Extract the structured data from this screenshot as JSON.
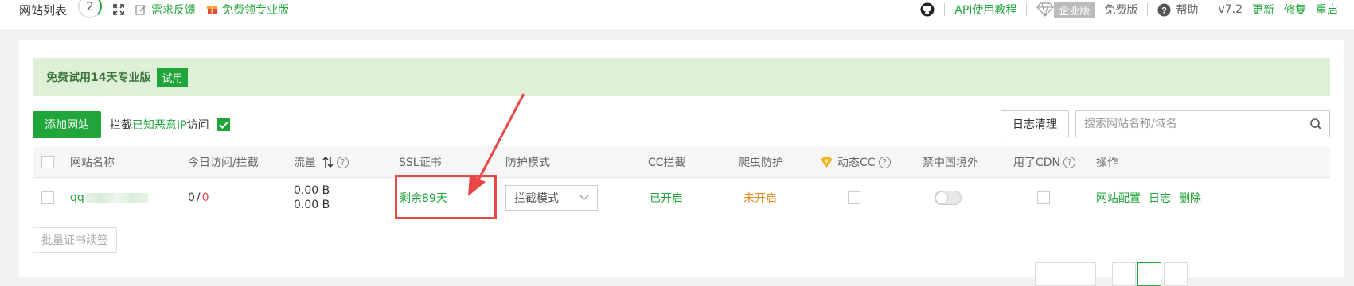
{
  "topbar": {
    "title": "网站列表",
    "site_count": "2",
    "feedback": "需求反馈",
    "free_pro": "免费领专业版",
    "api_tutorial": "API使用教程",
    "enterprise": "企业版",
    "free_edition": "免费版",
    "help": "帮助",
    "version": "v7.2",
    "update": "更新",
    "repair": "修复",
    "restart": "重启"
  },
  "notice": {
    "text": "免费试用14天专业版",
    "try_label": "试用"
  },
  "toolbar": {
    "add_site": "添加网站",
    "block_prefix": "拦截",
    "block_link": "已知恶意IP",
    "block_suffix": "访问",
    "log_clean": "日志清理",
    "search_placeholder": "搜索网站名称/域名"
  },
  "table": {
    "headers": {
      "name": "网站名称",
      "visits": "今日访问/拦截",
      "traffic": "流量",
      "ssl": "SSL证书",
      "protect_mode": "防护模式",
      "cc": "CC拦截",
      "crawler": "爬虫防护",
      "dynamic_cc": "动态CC",
      "block_foreign": "禁中国境外",
      "cdn": "用了CDN",
      "actions": "操作"
    },
    "rows": [
      {
        "name": "qq",
        "visits": "0",
        "visits_sep": "/",
        "blocked": "0",
        "traffic_in": "0.00 B",
        "traffic_out": "0.00 B",
        "ssl": "剩余89天",
        "protect_mode": "拦截模式",
        "cc": "已开启",
        "crawler": "未开启",
        "action_config": "网站配置",
        "action_log": "日志",
        "action_delete": "删除"
      }
    ]
  },
  "batch": {
    "renew_ssl": "批量证书续签"
  },
  "colors": {
    "primary": "#20a53a",
    "danger": "#e84848",
    "warning": "#e08a1e"
  }
}
